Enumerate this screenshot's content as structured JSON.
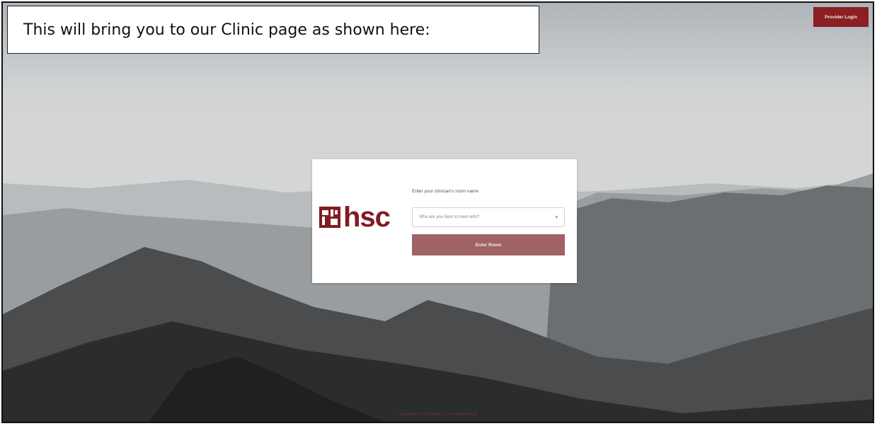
{
  "callout": {
    "text": "This will bring you to our Clinic page as shown here:"
  },
  "header": {
    "provider_login_label": "Provider Login"
  },
  "card": {
    "logo_text": "hsc",
    "label": "Enter your clinician's room name",
    "select_placeholder": "Who are you here to meet with?",
    "enter_button_label": "Enter Room"
  },
  "footer": {
    "text": "Copyright © 2020 Doxy.me, Inc. All rights reserved"
  },
  "colors": {
    "brand": "#7f1d22",
    "button": "#a06264",
    "provider_button": "#8b1f22"
  },
  "icons": {
    "logo": "hsc-logo-mark",
    "select_chevron": "chevron-down-icon"
  }
}
